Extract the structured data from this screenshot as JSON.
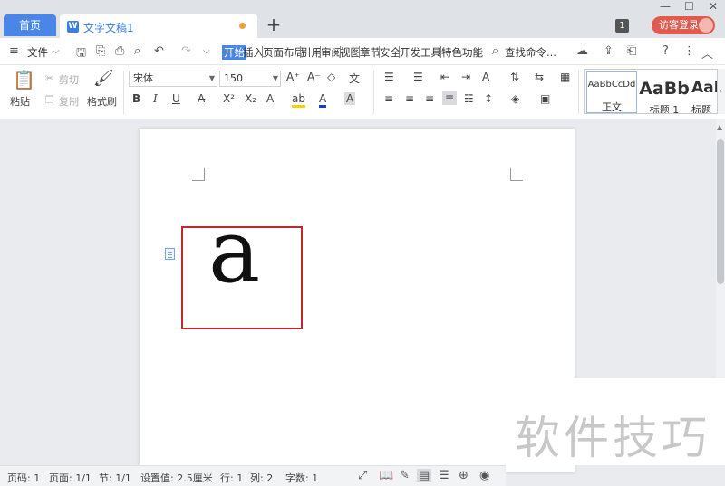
{
  "tabs": {
    "home": "首页",
    "doc_title": "文字文稿1",
    "add": "+"
  },
  "window": {
    "minimize": "—",
    "maximize": "☐",
    "close": "✕",
    "badge": "1",
    "guest_login": "访客登录"
  },
  "menu": {
    "file": "文件",
    "items": [
      "开始",
      "插入",
      "页面布局",
      "引用",
      "审阅",
      "视图",
      "章节",
      "安全",
      "开发工具",
      "特色功能"
    ],
    "search": "查找命令..."
  },
  "ribbon": {
    "paste": "粘贴",
    "cut": "剪切",
    "copy": "复制",
    "format_painter": "格式刷",
    "font_name": "宋体",
    "font_size": "150",
    "styles": [
      {
        "sample": "AaBbCcDd",
        "label": "正文"
      },
      {
        "sample": "AaBb",
        "label": "标题 1"
      },
      {
        "sample": "AaI",
        "label": "标题"
      }
    ]
  },
  "document": {
    "content": "a"
  },
  "watermark": "软件技巧",
  "status": {
    "page_num": "页码: 1",
    "page": "页面: 1/1",
    "section": "节: 1/1",
    "setting": "设置值: 2.5厘米",
    "row": "行: 1",
    "col": "列: 2",
    "words": "字数: 1"
  }
}
